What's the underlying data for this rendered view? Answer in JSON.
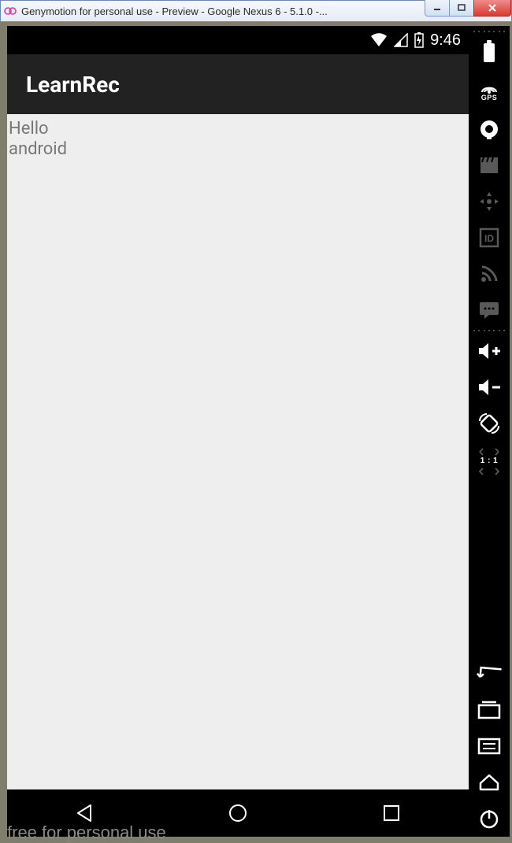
{
  "window": {
    "title": "Genymotion for personal use - Preview - Google Nexus 6 - 5.1.0 -..."
  },
  "statusbar": {
    "time": "9:46"
  },
  "actionbar": {
    "title": "LearnRec"
  },
  "content": {
    "line1": "Hello",
    "line2": "android"
  },
  "sidebar": {
    "gps_label": "GPS",
    "zoom_label": "1 : 1"
  },
  "footer": {
    "text": "free for personal use"
  }
}
